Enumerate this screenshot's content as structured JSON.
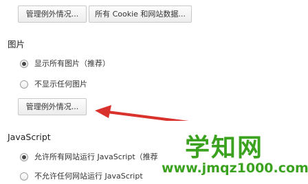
{
  "top_buttons": {
    "manage_exceptions": "管理例外情况...",
    "all_cookies": "所有 Cookie 和网站数据..."
  },
  "images_section": {
    "title": "图片",
    "options": [
      {
        "label": "显示所有图片（推荐）",
        "checked": true
      },
      {
        "label": "不显示任何图片",
        "checked": false
      }
    ],
    "manage_exceptions": "管理例外情况..."
  },
  "javascript_section": {
    "title": "JavaScript",
    "options": [
      {
        "label": "允许所有网站运行 JavaScript（推荐",
        "checked": true
      },
      {
        "label": "不允许任何网站运行 JavaScript",
        "checked": false
      }
    ]
  },
  "watermark": {
    "title": "学知网",
    "url": "www.jmqz1000.com"
  },
  "colors": {
    "arrow": "#d9312b",
    "watermark": "#3aa21f"
  },
  "icons": [
    "annotation-arrow-icon"
  ]
}
